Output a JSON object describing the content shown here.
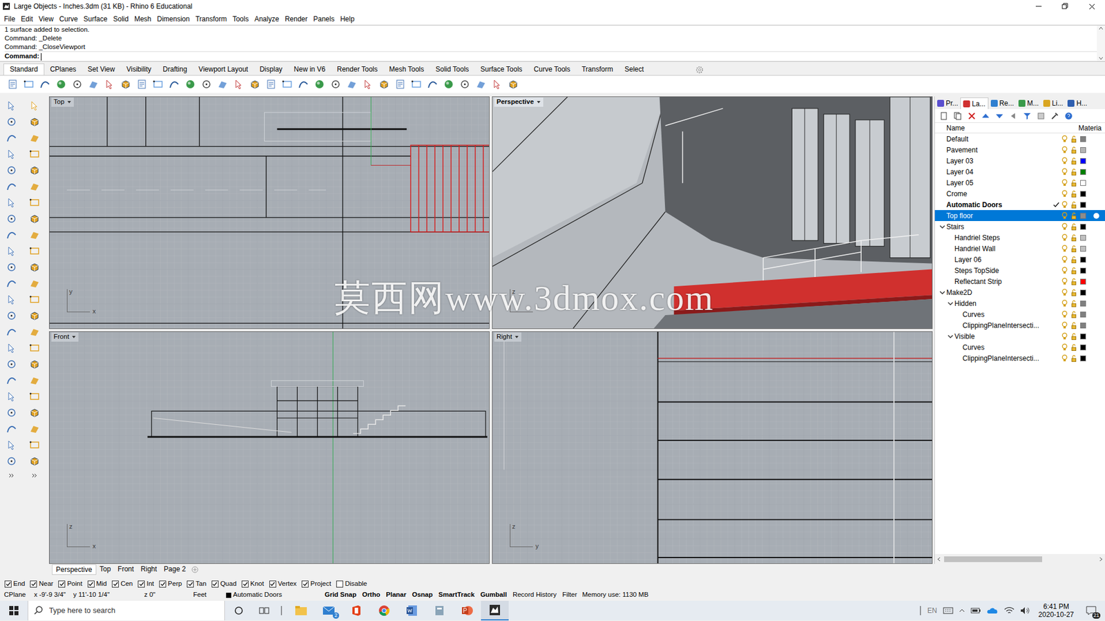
{
  "window": {
    "title": "Large Objects - Inches.3dm (31 KB) - Rhino 6 Educational"
  },
  "menu": [
    "File",
    "Edit",
    "View",
    "Curve",
    "Surface",
    "Solid",
    "Mesh",
    "Dimension",
    "Transform",
    "Tools",
    "Analyze",
    "Render",
    "Panels",
    "Help"
  ],
  "command": {
    "history": [
      "1 surface added to selection.",
      "Command: _Delete",
      "Command: _CloseViewport"
    ],
    "prompt": "Command:"
  },
  "toolbar_tabs": [
    {
      "label": "Standard",
      "selected": true
    },
    {
      "label": "CPlanes",
      "selected": false
    },
    {
      "label": "Set View",
      "selected": false
    },
    {
      "label": "Visibility",
      "selected": false
    },
    {
      "label": "Drafting",
      "selected": false
    },
    {
      "label": "Viewport Layout",
      "selected": false
    },
    {
      "label": "Display",
      "selected": false
    },
    {
      "label": "New in V6",
      "selected": false
    },
    {
      "label": "Render Tools",
      "selected": false
    },
    {
      "label": "Mesh Tools",
      "selected": false
    },
    {
      "label": "Solid Tools",
      "selected": false
    },
    {
      "label": "Surface Tools",
      "selected": false
    },
    {
      "label": "Curve Tools",
      "selected": false
    },
    {
      "label": "Transform",
      "selected": false
    },
    {
      "label": "Select",
      "selected": false
    }
  ],
  "viewports": [
    {
      "label": "Top",
      "active": false,
      "axes": [
        {
          "label": "y",
          "dir": "vertical"
        },
        {
          "label": "x",
          "dir": "horizontal"
        }
      ]
    },
    {
      "label": "Perspective",
      "active": true,
      "axes": [
        {
          "label": "z",
          "dir": "vertical"
        }
      ]
    },
    {
      "label": "Front",
      "active": false,
      "axes": [
        {
          "label": "z",
          "dir": "vertical"
        },
        {
          "label": "x",
          "dir": "horizontal"
        }
      ]
    },
    {
      "label": "Right",
      "active": false,
      "axes": [
        {
          "label": "z",
          "dir": "vertical"
        },
        {
          "label": "y",
          "dir": "horizontal"
        }
      ]
    }
  ],
  "watermark": "莫西网www.3dmox.com",
  "viewport_tabs": [
    {
      "label": "Perspective",
      "selected": true
    },
    {
      "label": "Top",
      "selected": false
    },
    {
      "label": "Front",
      "selected": false
    },
    {
      "label": "Right",
      "selected": false
    },
    {
      "label": "Page 2",
      "selected": false
    }
  ],
  "osnaps": [
    {
      "label": "End",
      "checked": true
    },
    {
      "label": "Near",
      "checked": true
    },
    {
      "label": "Point",
      "checked": true
    },
    {
      "label": "Mid",
      "checked": true
    },
    {
      "label": "Cen",
      "checked": true
    },
    {
      "label": "Int",
      "checked": true
    },
    {
      "label": "Perp",
      "checked": true
    },
    {
      "label": "Tan",
      "checked": true
    },
    {
      "label": "Quad",
      "checked": true
    },
    {
      "label": "Knot",
      "checked": true
    },
    {
      "label": "Vertex",
      "checked": true
    },
    {
      "label": "Project",
      "checked": true
    },
    {
      "label": "Disable",
      "checked": false
    }
  ],
  "status_bar": {
    "cplane": "CPlane",
    "x": "x -9'-9 3/4\"",
    "y": "y 11'-10 1/4\"",
    "z": "z 0\"",
    "units": "Feet",
    "layer": {
      "name": "Automatic Doors",
      "color": "#000000"
    },
    "toggles": [
      {
        "label": "Grid Snap",
        "on": true
      },
      {
        "label": "Ortho",
        "on": true
      },
      {
        "label": "Planar",
        "on": true
      },
      {
        "label": "Osnap",
        "on": true
      },
      {
        "label": "SmartTrack",
        "on": true
      },
      {
        "label": "Gumball",
        "on": true
      },
      {
        "label": "Record History",
        "on": false
      },
      {
        "label": "Filter",
        "on": false
      }
    ],
    "memory": "Memory use: 1130 MB"
  },
  "panel": {
    "tabs": [
      {
        "label": "Pr...",
        "selected": false,
        "color": "#5a4fcf"
      },
      {
        "label": "La...",
        "selected": true,
        "color": "#d03030"
      },
      {
        "label": "Re...",
        "selected": false,
        "color": "#2f7fd0"
      },
      {
        "label": "M...",
        "selected": false,
        "color": "#3a9a4a"
      },
      {
        "label": "Li...",
        "selected": false,
        "color": "#d9a520"
      },
      {
        "label": "H...",
        "selected": false,
        "color": "#2f5fb0"
      }
    ],
    "columns": [
      "Name",
      "Materia"
    ],
    "layers": [
      {
        "name": "Default",
        "depth": 0,
        "current": false,
        "selected": false,
        "color": "#808080"
      },
      {
        "name": "Pavement",
        "depth": 0,
        "current": false,
        "selected": false,
        "color": "#b4b4b4"
      },
      {
        "name": "Layer 03",
        "depth": 0,
        "current": false,
        "selected": false,
        "color": "#0000ff"
      },
      {
        "name": "Layer 04",
        "depth": 0,
        "current": false,
        "selected": false,
        "color": "#008000"
      },
      {
        "name": "Layer 05",
        "depth": 0,
        "current": false,
        "selected": false,
        "color": "#ffffff"
      },
      {
        "name": "Crome",
        "depth": 0,
        "current": false,
        "selected": false,
        "color": "#000000"
      },
      {
        "name": "Automatic Doors",
        "depth": 0,
        "current": true,
        "selected": false,
        "color": "#000000"
      },
      {
        "name": "Top floor",
        "depth": 0,
        "current": false,
        "selected": true,
        "color": "#8c8c8c"
      },
      {
        "name": "Stairs",
        "depth": 0,
        "expanded": true,
        "current": false,
        "selected": false,
        "color": "#000000"
      },
      {
        "name": "Handriel Steps",
        "depth": 1,
        "current": false,
        "selected": false,
        "color": "#c0c0c0"
      },
      {
        "name": "Handriel Wall",
        "depth": 1,
        "current": false,
        "selected": false,
        "color": "#c0c0c0"
      },
      {
        "name": "Layer 06",
        "depth": 1,
        "current": false,
        "selected": false,
        "color": "#000000"
      },
      {
        "name": "Steps TopSide",
        "depth": 1,
        "current": false,
        "selected": false,
        "color": "#000000"
      },
      {
        "name": "Reflectant Strip",
        "depth": 1,
        "current": false,
        "selected": false,
        "color": "#ff0000"
      },
      {
        "name": "Make2D",
        "depth": 0,
        "expanded": true,
        "current": false,
        "selected": false,
        "color": "#000000"
      },
      {
        "name": "Hidden",
        "depth": 1,
        "expanded": true,
        "current": false,
        "selected": false,
        "color": "#808080"
      },
      {
        "name": "Curves",
        "depth": 2,
        "current": false,
        "selected": false,
        "color": "#808080"
      },
      {
        "name": "ClippingPlaneIntersecti...",
        "depth": 2,
        "current": false,
        "selected": false,
        "color": "#808080"
      },
      {
        "name": "Visible",
        "depth": 1,
        "expanded": true,
        "current": false,
        "selected": false,
        "color": "#000000"
      },
      {
        "name": "Curves",
        "depth": 2,
        "current": false,
        "selected": false,
        "color": "#000000"
      },
      {
        "name": "ClippingPlaneIntersecti...",
        "depth": 2,
        "current": false,
        "selected": false,
        "color": "#000000"
      }
    ]
  },
  "taskbar": {
    "search_placeholder": "Type here to search",
    "mail_badge": "2",
    "language": "EN",
    "time": "6:41 PM",
    "date": "2020-10-27",
    "notifications": "21"
  }
}
